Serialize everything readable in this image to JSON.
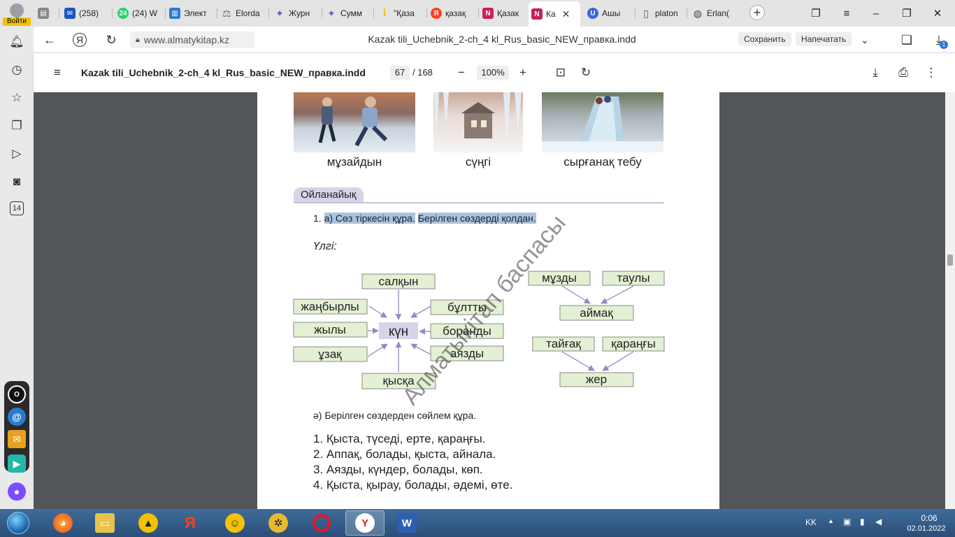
{
  "tabs": [
    {
      "label": "",
      "icon": "page-icon",
      "color": "#888888"
    },
    {
      "label": "(258)",
      "icon": "mail-icon",
      "color": "#1a55c4"
    },
    {
      "label": "(24) W",
      "icon": "whatsapp-icon",
      "color": "#25d366"
    },
    {
      "label": "Элект",
      "icon": "book-icon",
      "color": "#2a7bd1"
    },
    {
      "label": "Elorda",
      "icon": "scales-icon",
      "color": "#7a6a5a"
    },
    {
      "label": "Журн",
      "icon": "journal-icon",
      "color": "#5d63c9"
    },
    {
      "label": "Сумм",
      "icon": "journal-icon",
      "color": "#5d63c9"
    },
    {
      "label": "\"Қаза",
      "icon": "info-icon",
      "color": "#f2c200"
    },
    {
      "label": "қазақ",
      "icon": "yandex-icon",
      "color": "#fc3f1d"
    },
    {
      "label": "Қазак",
      "icon": "pdf-icon",
      "color": "#c8205a"
    },
    {
      "label": "Ка",
      "icon": "pdf-icon",
      "color": "#c8205a",
      "active": true
    },
    {
      "label": "Ашы",
      "icon": "u-icon",
      "color": "#3a67d8"
    },
    {
      "label": "platon",
      "icon": "doc-icon",
      "color": "#777777"
    },
    {
      "label": "Erlan(",
      "icon": "globe-icon",
      "color": "#444444"
    }
  ],
  "signin": {
    "label": "Войти"
  },
  "sidebar": {
    "badge_number": "14"
  },
  "address": {
    "url": "www.almatykitap.kz",
    "page_title": "Kazak tili_Uchebnik_2-ch_4 kl_Rus_basic_NEW_правка.indd",
    "save_label": "Сохранить",
    "print_label": "Напечатать",
    "download_badge": "1"
  },
  "pdf": {
    "title": "Kazak tili_Uchebnik_2-ch_4 kl_Rus_basic_NEW_правка.indd",
    "page_current": "67",
    "page_total": "/ 168",
    "zoom": "100%"
  },
  "content": {
    "captions": [
      "мұзайдын",
      "сүңгі",
      "сырғанақ тебу"
    ],
    "section": "Ойланайық",
    "task1_number": "1.",
    "task1_part1": "а) Сөз тіркесін құра.",
    "task1_part2": "Берілген сөздерді қолдан.",
    "sample": "Үлгі:",
    "diagram1": {
      "center": "күн",
      "words": [
        "салқын",
        "жаңбырлы",
        "бұлтты",
        "жылы",
        "боранды",
        "ұзақ",
        "аязды",
        "қысқа"
      ]
    },
    "diagram2": {
      "top": [
        "мұзды",
        "таулы"
      ],
      "center": "аймақ"
    },
    "diagram3": {
      "top": [
        "тайғақ",
        "қараңғы"
      ],
      "center": "жер"
    },
    "task2": "ә) Берілген сөздерден сөйлем құра.",
    "sentences": [
      "1. Қыста, түседі, ерте, қараңғы.",
      "2. Аппақ, болады, қыста, айнала.",
      "3. Аязды, күндер, болады, көп.",
      "4. Қыста, қырау, болады, әдемі, өте."
    ],
    "watermark": "Алматыкітап баспасы"
  },
  "taskbar": {
    "lang": "KK",
    "time": "0:06",
    "date": "02.01.2022"
  },
  "colors": {
    "word_box": "#e3f0d4",
    "center_box": "#d9d3e8",
    "arrow": "#9b86c4",
    "highlight": "#a9c4e0"
  }
}
